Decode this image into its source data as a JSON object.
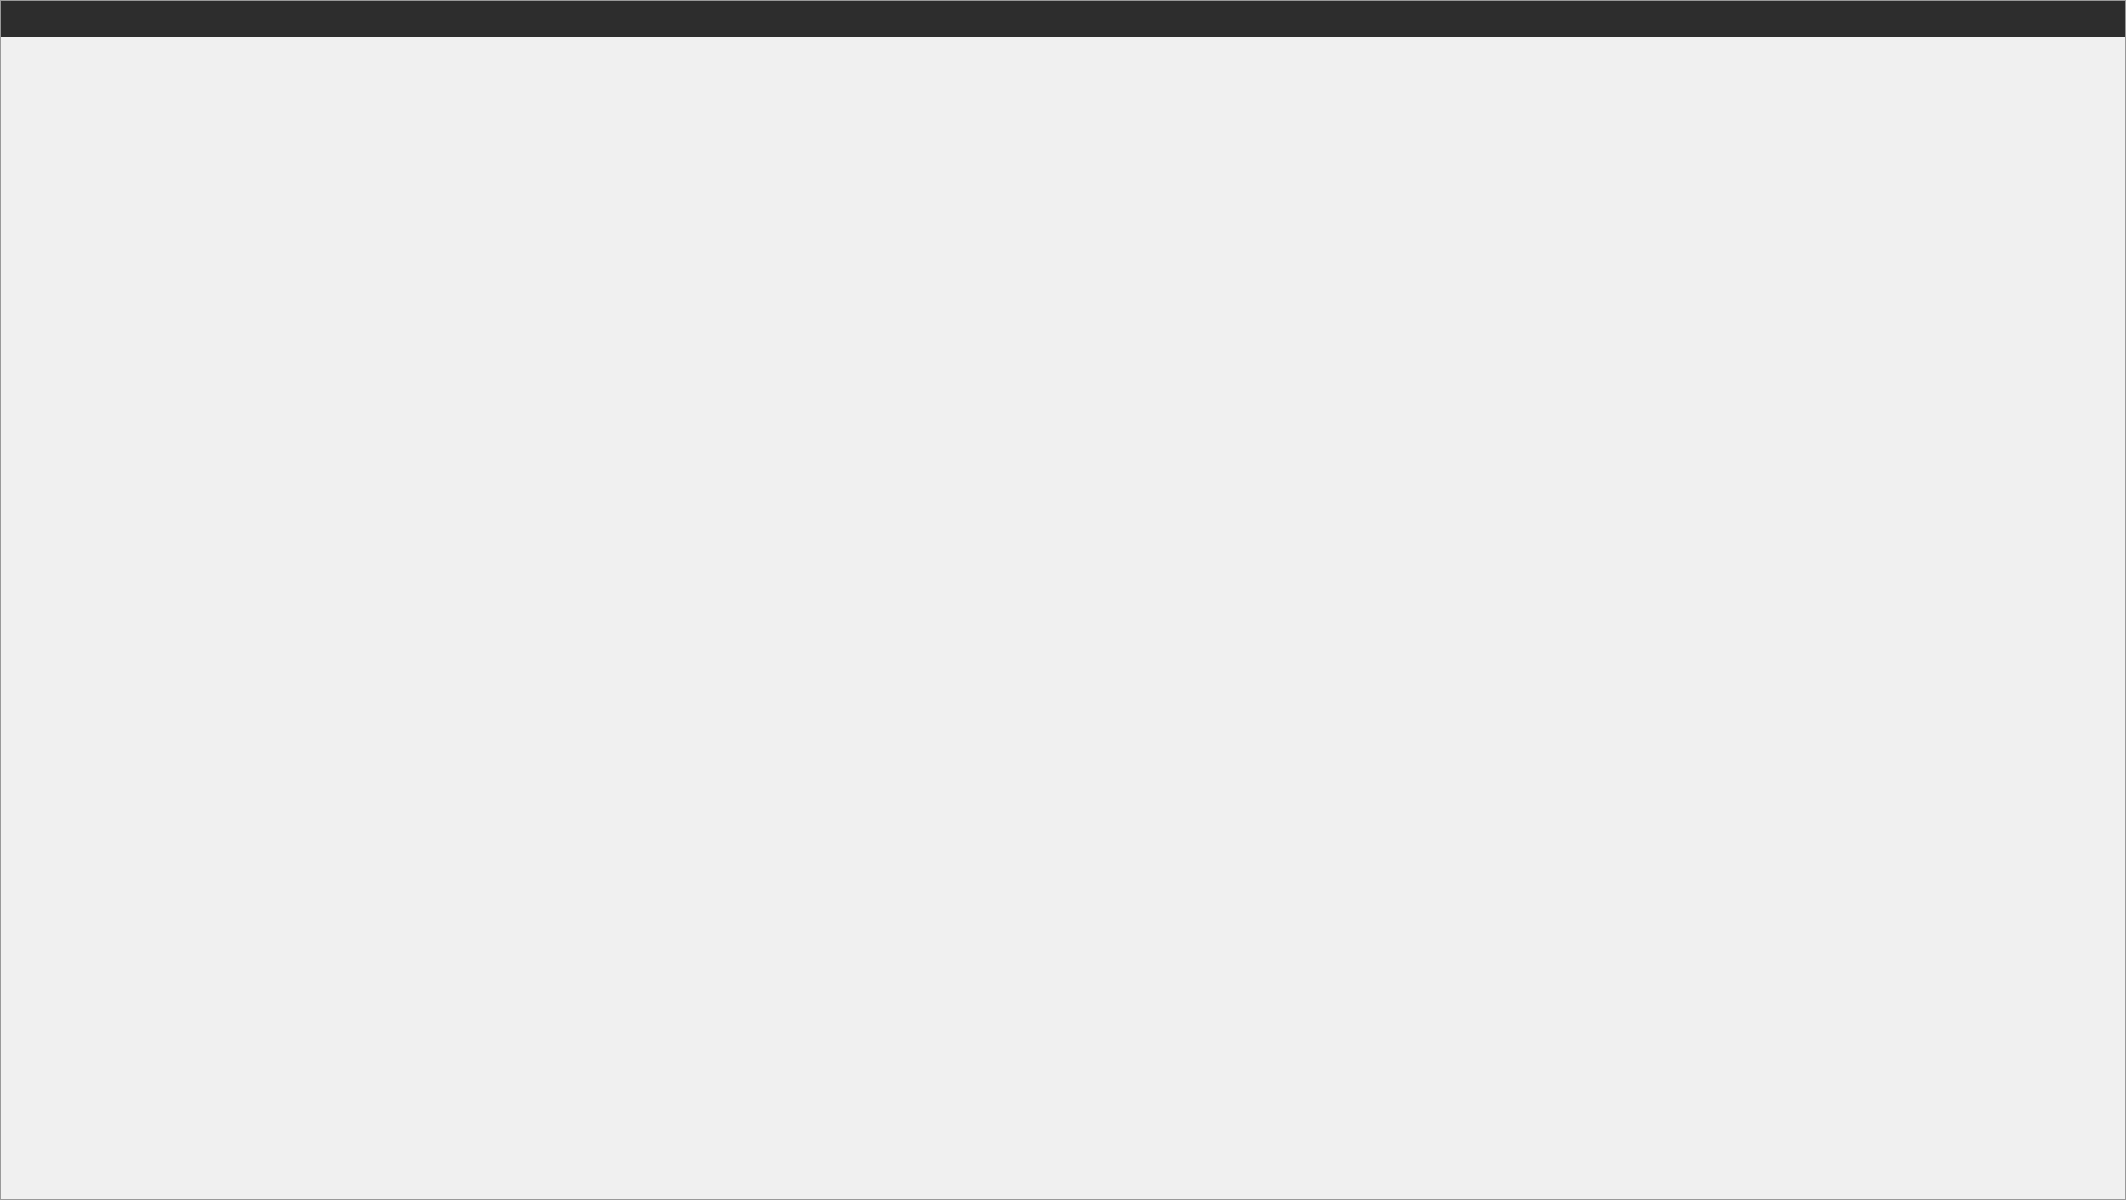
{
  "window": {
    "title": ""
  },
  "placeholder": {
    "text": ""
  }
}
